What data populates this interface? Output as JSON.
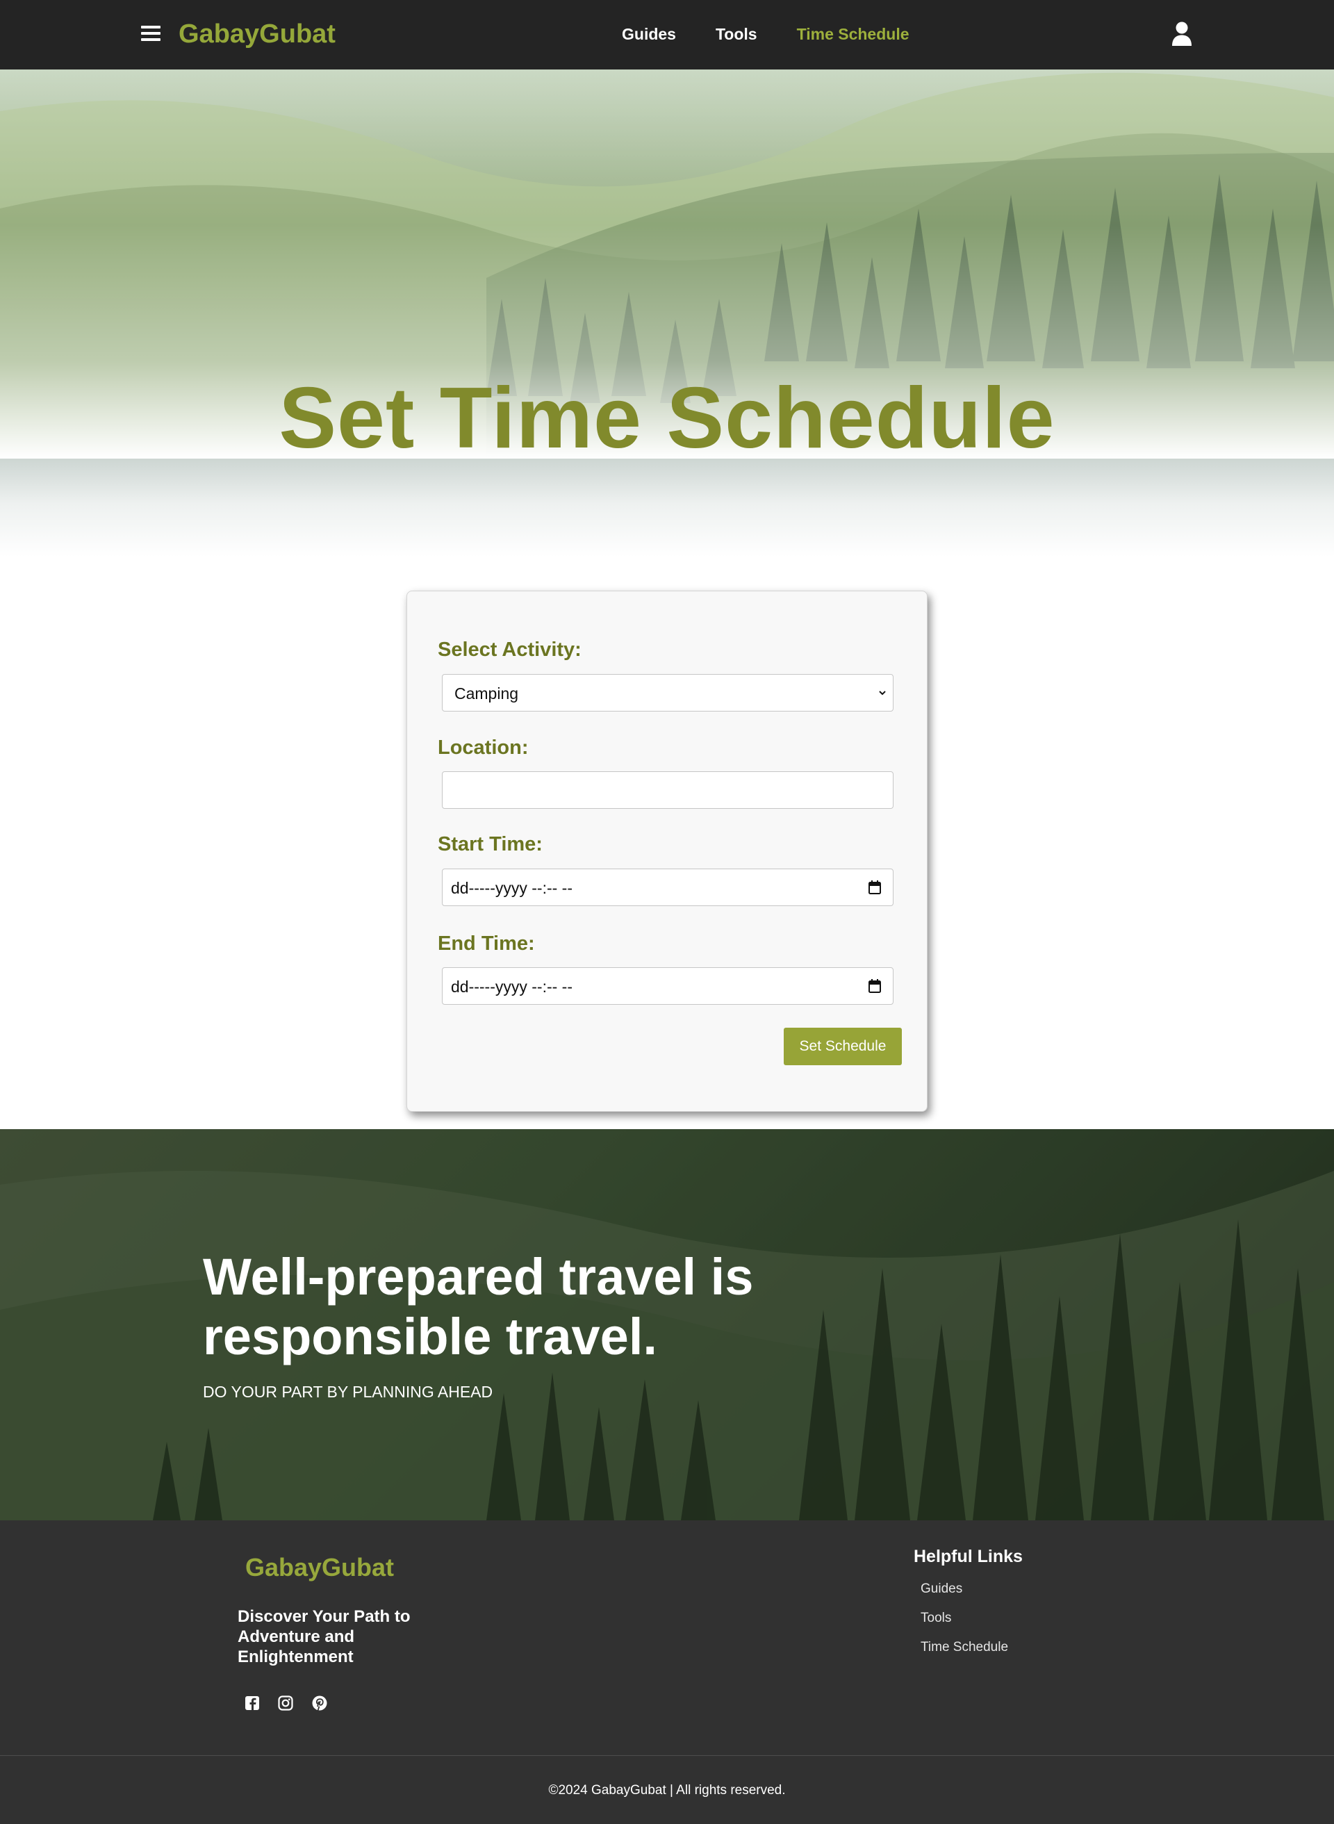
{
  "nav": {
    "brand": "GabayGubat",
    "links": [
      "Guides",
      "Tools",
      "Time Schedule"
    ],
    "active_link": "Time Schedule",
    "menu_icon": "hamburger-menu-icon",
    "profile_icon": "user-icon"
  },
  "hero": {
    "title": "Set Time Schedule"
  },
  "form": {
    "activity_label": "Select Activity:",
    "activity_value": "Camping",
    "location_label": "Location:",
    "location_value": "",
    "start_label": "Start Time:",
    "start_value": "dd-----yyyy --:-- --",
    "end_label": "End Time:",
    "end_value": "dd-----yyyy --:-- --",
    "submit_label": "Set Schedule"
  },
  "banner": {
    "title": "Well-prepared travel is responsible travel.",
    "subtitle": "DO YOUR PART BY PLANNING AHEAD"
  },
  "footer": {
    "brand": "GabayGubat",
    "tagline": "Discover Your Path to Adventure and Enlightenment",
    "social_icons": [
      "facebook-icon",
      "instagram-icon",
      "pinterest-icon"
    ],
    "links_title": "Helpful Links",
    "links": [
      "Guides",
      "Tools",
      "Time Schedule"
    ],
    "copyright": "©2024 GabayGubat | All rights reserved."
  },
  "colors": {
    "brand_green": "#95a83a",
    "heading_olive": "#818a2c",
    "label_olive": "#6b7521",
    "button_green": "#97a437",
    "nav_bg": "#242424",
    "footer_bg": "#313131"
  }
}
